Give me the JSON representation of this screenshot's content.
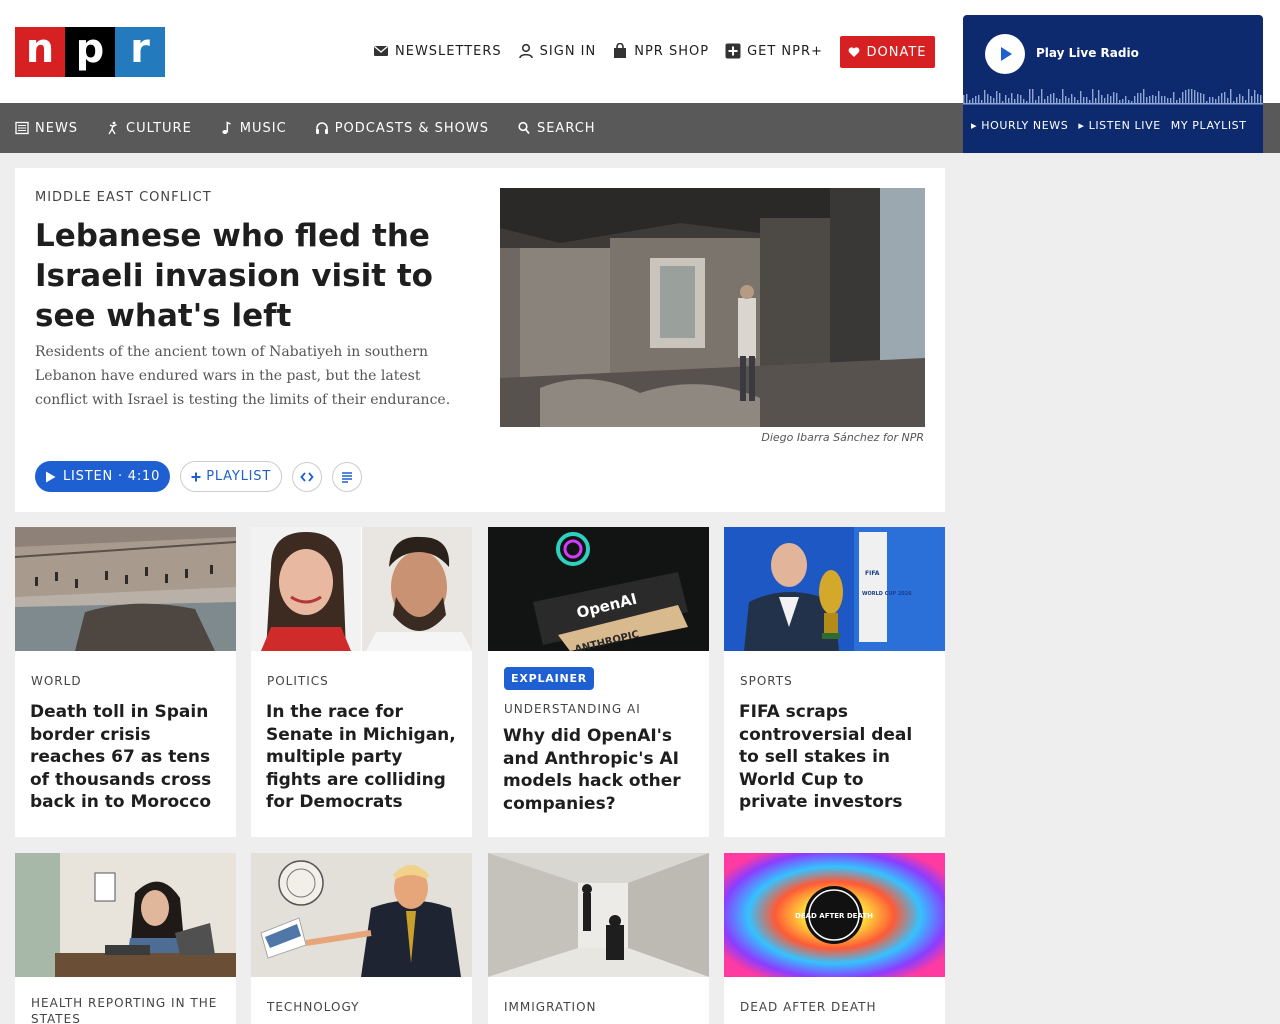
{
  "logo": {
    "letters": [
      "n",
      "p",
      "r"
    ]
  },
  "utility": {
    "newsletters": "NEWSLETTERS",
    "sign_in": "SIGN IN",
    "shop": "NPR SHOP",
    "plus": "GET NPR+",
    "donate": "DONATE"
  },
  "player": {
    "play_label": "Play Live Radio",
    "links": [
      "HOURLY NEWS",
      "LISTEN LIVE",
      "MY PLAYLIST"
    ]
  },
  "nav": {
    "items": [
      "NEWS",
      "CULTURE",
      "MUSIC",
      "PODCASTS & SHOWS",
      "SEARCH"
    ]
  },
  "hero": {
    "kicker": "MIDDLE EAST CONFLICT",
    "title": "Lebanese who fled the Israeli invasion visit to see what's left",
    "teaser": "Residents of the ancient town of Nabatiyeh in southern Lebanon have endured wars in the past, but the latest conflict with Israel is testing the limits of their endurance.",
    "credit": "Diego Ibarra Sánchez for NPR",
    "listen": "LISTEN · 4:10",
    "playlist": "PLAYLIST"
  },
  "cards": [
    {
      "kicker": "WORLD",
      "title": "Death toll in Spain border crisis reaches 67 as tens of thousands cross back in to Morocco"
    },
    {
      "kicker": "POLITICS",
      "title": "In the race for Senate in Michigan, multiple party fights are colliding for Democrats"
    },
    {
      "tag": "EXPLAINER",
      "kicker": "UNDERSTANDING AI",
      "title": "Why did OpenAI's and Anthropic's AI models hack other companies?",
      "img_text_1": "OpenAI",
      "img_text_2": "ANTHROPIC"
    },
    {
      "kicker": "SPORTS",
      "title": "FIFA scraps controversial deal to sell stakes in World Cup to private investors",
      "img_text_1": "FIFA",
      "img_text_2": "WORLD CUP 2026"
    }
  ],
  "cards_row2": [
    {
      "kicker": "HEALTH REPORTING IN THE STATES"
    },
    {
      "kicker": "TECHNOLOGY"
    },
    {
      "kicker": "IMMIGRATION"
    },
    {
      "kicker": "DEAD AFTER DEATH",
      "img_text": "DEAD AFTER DEATH"
    }
  ],
  "colors": {
    "npr_red": "#d62021",
    "npr_blue": "#237bbd",
    "player_navy": "#0e2a6e",
    "nav_gray": "#595959",
    "link_blue": "#1e5fd1"
  }
}
